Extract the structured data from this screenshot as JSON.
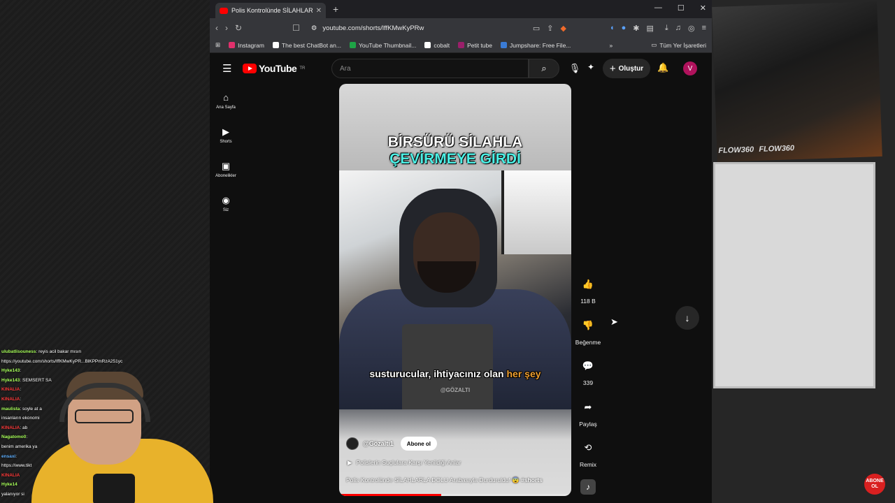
{
  "browser": {
    "tab_title": "Polis Kontrolünde SİLAHLARLA D",
    "url": "youtube.com/shorts/lffKMwKyPRw",
    "bookmarks": [
      {
        "label": "Instagram",
        "color": "#e1306c"
      },
      {
        "label": "The best ChatBot an...",
        "color": "#ffffff"
      },
      {
        "label": "YouTube Thumbnail...",
        "color": "#1ea446"
      },
      {
        "label": "cobalt",
        "color": "#ffffff"
      },
      {
        "label": "Petit tube",
        "color": "#9a1f6a"
      },
      {
        "label": "Jumpshare: Free File...",
        "color": "#3a7bd5"
      }
    ],
    "bookmarks_more": "»",
    "all_bookmarks": "Tüm Yer İşaretleri"
  },
  "youtube": {
    "logo_text": "YouTube",
    "logo_region": "TR",
    "search_placeholder": "Ara",
    "create_label": "Oluştur",
    "avatar_letter": "V",
    "sidebar": [
      {
        "icon": "home-icon",
        "glyph": "⌂",
        "label": "Ana Sayfa"
      },
      {
        "icon": "shorts-icon",
        "glyph": "▶",
        "label": "Shorts"
      },
      {
        "icon": "subscriptions-icon",
        "glyph": "▣",
        "label": "Abonelikler"
      },
      {
        "icon": "you-icon",
        "glyph": "◉",
        "label": "Siz"
      }
    ]
  },
  "short": {
    "headline_line1": "BİRSÜRÜ SİLAHLA",
    "headline_line2": "ÇEVİRMEYE GİRDİ",
    "subtitle_main": "susturucular, ihtiyacınız olan",
    "subtitle_highlight": "her şey",
    "watermark": "@GÖZALTI",
    "channel": "@Gözaltı1",
    "subscribe_label": "Abone ol",
    "playlist": "Polislerin Suçlulara Karşı Yenildiği Anlar",
    "caption": "Polis Kontrolünde SİLAHLARLA DOLU Arabasıyla Durduruldu! 😨",
    "caption_tag": "#shorts",
    "progress_fraction": 0.44,
    "actions": {
      "like_count": "118 B",
      "dislike_label": "Beğenme",
      "comments_count": "339",
      "share_label": "Paylaş",
      "remix_label": "Remix"
    }
  },
  "chat": [
    {
      "user": "ulubatlisouness",
      "text": ": reyis acil bakar mısın",
      "color": "green"
    },
    {
      "user": "",
      "text": "https://youtube.com/shorts/lffKMwKyPR...BlKPPmRzA251yc",
      "color": "none"
    },
    {
      "user": "Hyke143",
      "text": ":",
      "color": "green"
    },
    {
      "user": "Hyke143",
      "text": ": SEMSERT SA",
      "color": "green"
    },
    {
      "user": "KINALIA",
      "text": ":",
      "color": "red"
    },
    {
      "user": "KINALIA",
      "text": ":",
      "color": "red"
    },
    {
      "user": "maulista",
      "text": ": soyle at a",
      "color": "green"
    },
    {
      "user": "",
      "text": "insanların ekonomi",
      "color": "none"
    },
    {
      "user": "KINALIA",
      "text": ": ab",
      "color": "red"
    },
    {
      "user": "Nagatomo0",
      "text": ":",
      "color": "green"
    },
    {
      "user": "",
      "text": "benim amerika ya",
      "color": "none"
    },
    {
      "user": "ensaxi",
      "text": ":",
      "color": "blue"
    },
    {
      "user": "",
      "text": "https://www.tikt",
      "color": "none"
    },
    {
      "user": "KINALIA",
      "text": "",
      "color": "red"
    },
    {
      "user": "Hyke14",
      "text": "",
      "color": "green"
    },
    {
      "user": "",
      "text": "yalanıyor si",
      "color": "none"
    }
  ],
  "overlay": {
    "poster_tag": "FLOW360",
    "stamp": "ABONE OL"
  }
}
